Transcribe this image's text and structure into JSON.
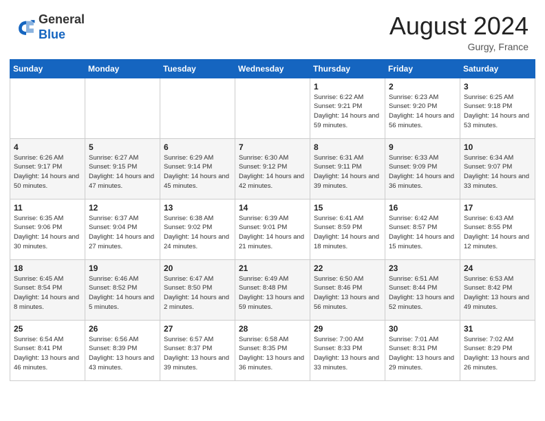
{
  "header": {
    "logo_general": "General",
    "logo_blue": "Blue",
    "month_year": "August 2024",
    "location": "Gurgy, France"
  },
  "weekdays": [
    "Sunday",
    "Monday",
    "Tuesday",
    "Wednesday",
    "Thursday",
    "Friday",
    "Saturday"
  ],
  "weeks": [
    [
      {
        "day": "",
        "sunrise": "",
        "sunset": "",
        "daylight": ""
      },
      {
        "day": "",
        "sunrise": "",
        "sunset": "",
        "daylight": ""
      },
      {
        "day": "",
        "sunrise": "",
        "sunset": "",
        "daylight": ""
      },
      {
        "day": "",
        "sunrise": "",
        "sunset": "",
        "daylight": ""
      },
      {
        "day": "1",
        "sunrise": "Sunrise: 6:22 AM",
        "sunset": "Sunset: 9:21 PM",
        "daylight": "Daylight: 14 hours and 59 minutes."
      },
      {
        "day": "2",
        "sunrise": "Sunrise: 6:23 AM",
        "sunset": "Sunset: 9:20 PM",
        "daylight": "Daylight: 14 hours and 56 minutes."
      },
      {
        "day": "3",
        "sunrise": "Sunrise: 6:25 AM",
        "sunset": "Sunset: 9:18 PM",
        "daylight": "Daylight: 14 hours and 53 minutes."
      }
    ],
    [
      {
        "day": "4",
        "sunrise": "Sunrise: 6:26 AM",
        "sunset": "Sunset: 9:17 PM",
        "daylight": "Daylight: 14 hours and 50 minutes."
      },
      {
        "day": "5",
        "sunrise": "Sunrise: 6:27 AM",
        "sunset": "Sunset: 9:15 PM",
        "daylight": "Daylight: 14 hours and 47 minutes."
      },
      {
        "day": "6",
        "sunrise": "Sunrise: 6:29 AM",
        "sunset": "Sunset: 9:14 PM",
        "daylight": "Daylight: 14 hours and 45 minutes."
      },
      {
        "day": "7",
        "sunrise": "Sunrise: 6:30 AM",
        "sunset": "Sunset: 9:12 PM",
        "daylight": "Daylight: 14 hours and 42 minutes."
      },
      {
        "day": "8",
        "sunrise": "Sunrise: 6:31 AM",
        "sunset": "Sunset: 9:11 PM",
        "daylight": "Daylight: 14 hours and 39 minutes."
      },
      {
        "day": "9",
        "sunrise": "Sunrise: 6:33 AM",
        "sunset": "Sunset: 9:09 PM",
        "daylight": "Daylight: 14 hours and 36 minutes."
      },
      {
        "day": "10",
        "sunrise": "Sunrise: 6:34 AM",
        "sunset": "Sunset: 9:07 PM",
        "daylight": "Daylight: 14 hours and 33 minutes."
      }
    ],
    [
      {
        "day": "11",
        "sunrise": "Sunrise: 6:35 AM",
        "sunset": "Sunset: 9:06 PM",
        "daylight": "Daylight: 14 hours and 30 minutes."
      },
      {
        "day": "12",
        "sunrise": "Sunrise: 6:37 AM",
        "sunset": "Sunset: 9:04 PM",
        "daylight": "Daylight: 14 hours and 27 minutes."
      },
      {
        "day": "13",
        "sunrise": "Sunrise: 6:38 AM",
        "sunset": "Sunset: 9:02 PM",
        "daylight": "Daylight: 14 hours and 24 minutes."
      },
      {
        "day": "14",
        "sunrise": "Sunrise: 6:39 AM",
        "sunset": "Sunset: 9:01 PM",
        "daylight": "Daylight: 14 hours and 21 minutes."
      },
      {
        "day": "15",
        "sunrise": "Sunrise: 6:41 AM",
        "sunset": "Sunset: 8:59 PM",
        "daylight": "Daylight: 14 hours and 18 minutes."
      },
      {
        "day": "16",
        "sunrise": "Sunrise: 6:42 AM",
        "sunset": "Sunset: 8:57 PM",
        "daylight": "Daylight: 14 hours and 15 minutes."
      },
      {
        "day": "17",
        "sunrise": "Sunrise: 6:43 AM",
        "sunset": "Sunset: 8:55 PM",
        "daylight": "Daylight: 14 hours and 12 minutes."
      }
    ],
    [
      {
        "day": "18",
        "sunrise": "Sunrise: 6:45 AM",
        "sunset": "Sunset: 8:54 PM",
        "daylight": "Daylight: 14 hours and 8 minutes."
      },
      {
        "day": "19",
        "sunrise": "Sunrise: 6:46 AM",
        "sunset": "Sunset: 8:52 PM",
        "daylight": "Daylight: 14 hours and 5 minutes."
      },
      {
        "day": "20",
        "sunrise": "Sunrise: 6:47 AM",
        "sunset": "Sunset: 8:50 PM",
        "daylight": "Daylight: 14 hours and 2 minutes."
      },
      {
        "day": "21",
        "sunrise": "Sunrise: 6:49 AM",
        "sunset": "Sunset: 8:48 PM",
        "daylight": "Daylight: 13 hours and 59 minutes."
      },
      {
        "day": "22",
        "sunrise": "Sunrise: 6:50 AM",
        "sunset": "Sunset: 8:46 PM",
        "daylight": "Daylight: 13 hours and 56 minutes."
      },
      {
        "day": "23",
        "sunrise": "Sunrise: 6:51 AM",
        "sunset": "Sunset: 8:44 PM",
        "daylight": "Daylight: 13 hours and 52 minutes."
      },
      {
        "day": "24",
        "sunrise": "Sunrise: 6:53 AM",
        "sunset": "Sunset: 8:42 PM",
        "daylight": "Daylight: 13 hours and 49 minutes."
      }
    ],
    [
      {
        "day": "25",
        "sunrise": "Sunrise: 6:54 AM",
        "sunset": "Sunset: 8:41 PM",
        "daylight": "Daylight: 13 hours and 46 minutes."
      },
      {
        "day": "26",
        "sunrise": "Sunrise: 6:56 AM",
        "sunset": "Sunset: 8:39 PM",
        "daylight": "Daylight: 13 hours and 43 minutes."
      },
      {
        "day": "27",
        "sunrise": "Sunrise: 6:57 AM",
        "sunset": "Sunset: 8:37 PM",
        "daylight": "Daylight: 13 hours and 39 minutes."
      },
      {
        "day": "28",
        "sunrise": "Sunrise: 6:58 AM",
        "sunset": "Sunset: 8:35 PM",
        "daylight": "Daylight: 13 hours and 36 minutes."
      },
      {
        "day": "29",
        "sunrise": "Sunrise: 7:00 AM",
        "sunset": "Sunset: 8:33 PM",
        "daylight": "Daylight: 13 hours and 33 minutes."
      },
      {
        "day": "30",
        "sunrise": "Sunrise: 7:01 AM",
        "sunset": "Sunset: 8:31 PM",
        "daylight": "Daylight: 13 hours and 29 minutes."
      },
      {
        "day": "31",
        "sunrise": "Sunrise: 7:02 AM",
        "sunset": "Sunset: 8:29 PM",
        "daylight": "Daylight: 13 hours and 26 minutes."
      }
    ]
  ]
}
